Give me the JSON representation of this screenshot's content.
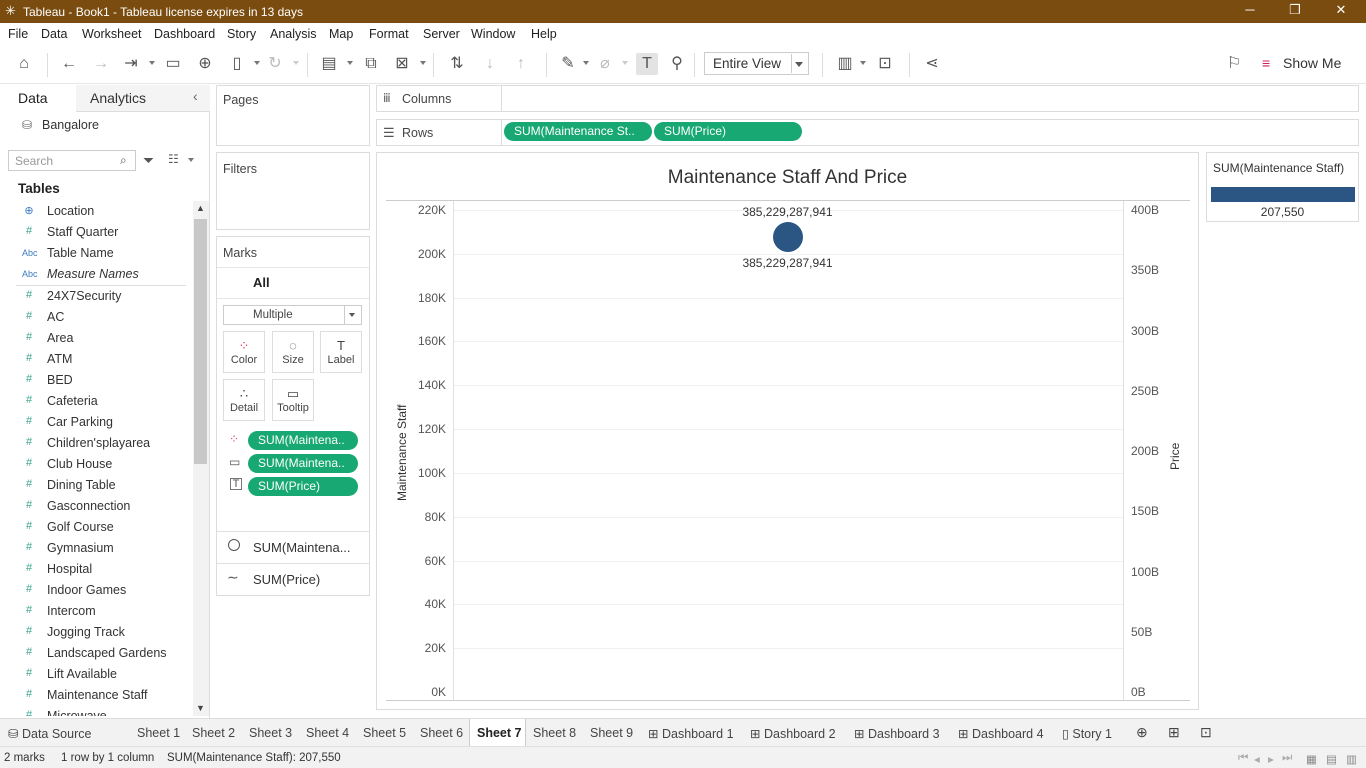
{
  "window": {
    "title": "Tableau - Book1 - Tableau license expires in 13 days"
  },
  "menu": [
    "File",
    "Data",
    "Worksheet",
    "Dashboard",
    "Story",
    "Analysis",
    "Map",
    "Format",
    "Server",
    "Window",
    "Help"
  ],
  "toolbar": {
    "view_mode": "Entire View",
    "show_me": "Show Me"
  },
  "left_panel": {
    "tabs": [
      "Data",
      "Analytics"
    ],
    "datasource": "Bangalore",
    "search_placeholder": "Search",
    "tables_header": "Tables",
    "fields": [
      {
        "icon": "globe-icon",
        "type": "geo",
        "label": "Location"
      },
      {
        "icon": "hash-icon",
        "type": "num",
        "label": "Staff Quarter"
      },
      {
        "icon": "abc-icon",
        "type": "str",
        "label": "Table Name"
      },
      {
        "icon": "abc-icon",
        "type": "str",
        "label": "Measure Names"
      },
      {
        "icon": "hash-icon",
        "type": "num",
        "label": "24X7Security"
      },
      {
        "icon": "hash-icon",
        "type": "num",
        "label": "AC"
      },
      {
        "icon": "hash-icon",
        "type": "num",
        "label": "Area"
      },
      {
        "icon": "hash-icon",
        "type": "num",
        "label": "ATM"
      },
      {
        "icon": "hash-icon",
        "type": "num",
        "label": "BED"
      },
      {
        "icon": "hash-icon",
        "type": "num",
        "label": "Cafeteria"
      },
      {
        "icon": "hash-icon",
        "type": "num",
        "label": "Car Parking"
      },
      {
        "icon": "hash-icon",
        "type": "num",
        "label": "Children'splayarea"
      },
      {
        "icon": "hash-icon",
        "type": "num",
        "label": "Club House"
      },
      {
        "icon": "hash-icon",
        "type": "num",
        "label": "Dining Table"
      },
      {
        "icon": "hash-icon",
        "type": "num",
        "label": "Gasconnection"
      },
      {
        "icon": "hash-icon",
        "type": "num",
        "label": "Golf Course"
      },
      {
        "icon": "hash-icon",
        "type": "num",
        "label": "Gymnasium"
      },
      {
        "icon": "hash-icon",
        "type": "num",
        "label": "Hospital"
      },
      {
        "icon": "hash-icon",
        "type": "num",
        "label": "Indoor Games"
      },
      {
        "icon": "hash-icon",
        "type": "num",
        "label": "Intercom"
      },
      {
        "icon": "hash-icon",
        "type": "num",
        "label": "Jogging Track"
      },
      {
        "icon": "hash-icon",
        "type": "num",
        "label": "Landscaped Gardens"
      },
      {
        "icon": "hash-icon",
        "type": "num",
        "label": "Lift Available"
      },
      {
        "icon": "hash-icon",
        "type": "num",
        "label": "Maintenance Staff"
      },
      {
        "icon": "hash-icon",
        "type": "num",
        "label": "Microwave"
      }
    ]
  },
  "shelves": {
    "pages": "Pages",
    "filters": "Filters",
    "columns": "Columns",
    "rows": "Rows",
    "row_pills": [
      "SUM(Maintenance St..",
      "SUM(Price)"
    ]
  },
  "marks": {
    "title": "Marks",
    "all": "All",
    "mark_type": "Multiple",
    "buttons": [
      "Color",
      "Size",
      "Label",
      "Detail",
      "Tooltip"
    ],
    "encodings": [
      {
        "icon": "color-dots-icon",
        "pill": "SUM(Maintena.."
      },
      {
        "icon": "tooltip-icon",
        "pill": "SUM(Maintena.."
      },
      {
        "icon": "label-icon",
        "pill": "SUM(Price)"
      }
    ],
    "cards": [
      {
        "icon": "circle-icon",
        "label": "SUM(Maintena..."
      },
      {
        "icon": "line-icon",
        "label": "SUM(Price)"
      }
    ]
  },
  "legend": {
    "title": "SUM(Maintenance Staff)",
    "value": "207,550",
    "color": "#2b5583"
  },
  "chart_data": {
    "type": "scatter",
    "title": "Maintenance Staff And Price",
    "ylabel": "Maintenance Staff",
    "y2label": "Price",
    "ylim": [
      0,
      220000
    ],
    "y2lim": [
      0,
      400000000000
    ],
    "yticks": [
      "0K",
      "20K",
      "40K",
      "60K",
      "80K",
      "100K",
      "120K",
      "140K",
      "160K",
      "180K",
      "200K",
      "220K"
    ],
    "y2ticks": [
      "0B",
      "50B",
      "100B",
      "150B",
      "200B",
      "250B",
      "300B",
      "350B",
      "400B"
    ],
    "points": [
      {
        "maintenance_staff": 207550,
        "price": 385229287941
      }
    ],
    "labels": [
      "385,229,287,941",
      "385,229,287,941"
    ],
    "mark_color": "#2b5583",
    "grid": true
  },
  "sheet_tabs": [
    "Data Source",
    "Sheet 1",
    "Sheet 2",
    "Sheet 3",
    "Sheet 4",
    "Sheet 5",
    "Sheet 6",
    "Sheet 7",
    "Sheet 8",
    "Sheet 9",
    "Dashboard 1",
    "Dashboard 2",
    "Dashboard 3",
    "Dashboard 4",
    "Story 1"
  ],
  "active_tab": "Sheet 7",
  "status": {
    "marks": "2 marks",
    "dims": "1 row by 1 column",
    "sum": "SUM(Maintenance Staff): 207,550"
  }
}
